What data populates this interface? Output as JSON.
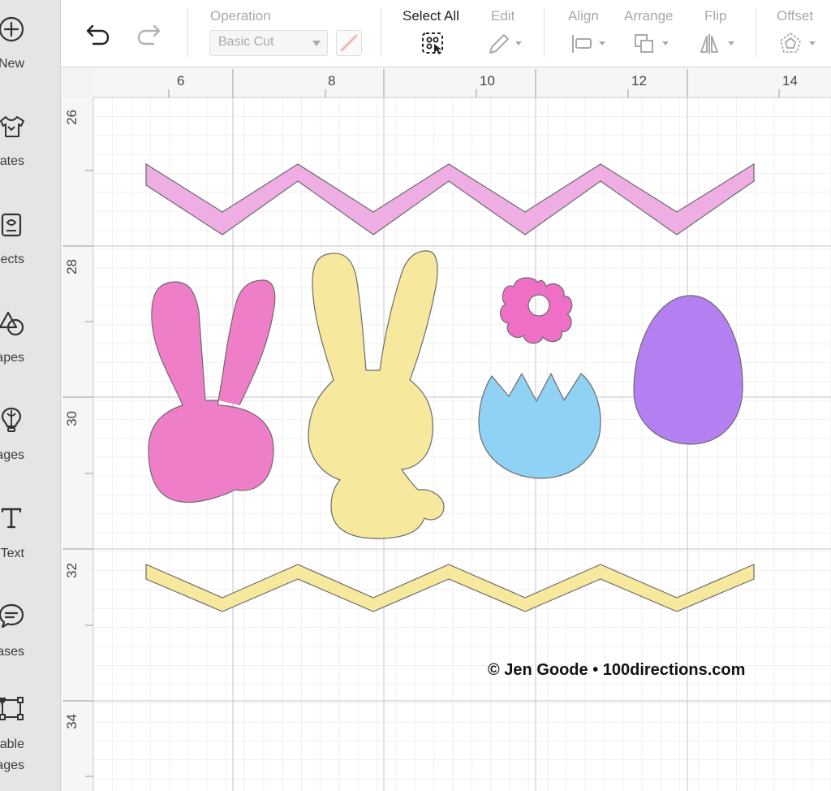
{
  "sidebar": {
    "items": [
      {
        "label": "New",
        "icon": "plus-circle-icon"
      },
      {
        "label": "Templates",
        "icon": "tshirt-icon"
      },
      {
        "label": "Projects",
        "icon": "projects-icon"
      },
      {
        "label": "Shapes",
        "icon": "shapes-icon"
      },
      {
        "label": "Images",
        "icon": "lightbulb-icon"
      },
      {
        "label": "Text",
        "icon": "text-icon"
      },
      {
        "label": "Phrases",
        "icon": "speech-bubble-icon"
      },
      {
        "label": "Editable",
        "label2": "Images",
        "icon": "vector-edit-icon"
      }
    ]
  },
  "toolbar": {
    "operation_label": "Operation",
    "operation_value": "Basic Cut",
    "select_all_label": "Select All",
    "edit_label": "Edit",
    "align_label": "Align",
    "arrange_label": "Arrange",
    "flip_label": "Flip",
    "offset_label": "Offset"
  },
  "ruler": {
    "x_labels": [
      "6",
      "8",
      "10",
      "12",
      "14"
    ],
    "y_labels": [
      "26",
      "28",
      "30",
      "32",
      "34"
    ]
  },
  "watermark": "© Jen Goode • 100directions.com",
  "colors": {
    "zigzag_top": "#eeaee3",
    "bunny_pink": "#ef7ec8",
    "bunny_yellow": "#f6e89d",
    "flower": "#ef6fc7",
    "egg_cracked": "#90d2f4",
    "egg_purple": "#b47ff0",
    "zigzag_bottom": "#f6e89d",
    "outline": "#6e6a6e",
    "sidebar_bg": "#e5e5e6"
  }
}
